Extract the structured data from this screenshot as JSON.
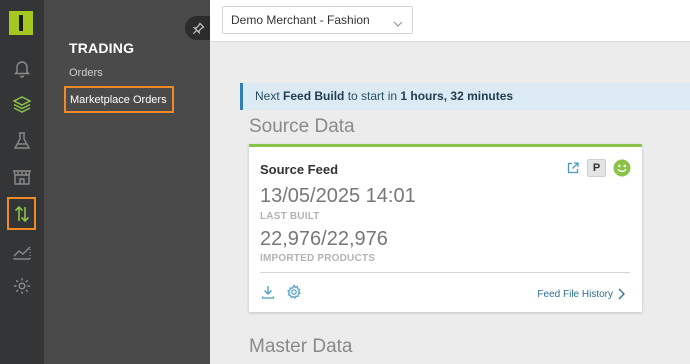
{
  "sidebar": {
    "icons": [
      "logo-icon",
      "bell-icon",
      "layers-icon",
      "flask-icon",
      "store-icon",
      "swap-arrows-icon",
      "area-chart-icon",
      "gear-icon"
    ],
    "active_icon": "swap-arrows-icon",
    "highlight_color": "#f08a24",
    "logo_color": "#a5c81f"
  },
  "subnav": {
    "title": "TRADING",
    "items": [
      {
        "label": "Orders"
      },
      {
        "label": "Marketplace Orders",
        "active": true
      }
    ]
  },
  "header": {
    "merchant_select": {
      "value": "Demo Merchant - Fashion"
    }
  },
  "notice": {
    "prefix": "Next ",
    "feed": "Feed Build",
    "middle": " to start in ",
    "time": "1 hours, 32 minutes"
  },
  "sections": {
    "source_title": "Source Data",
    "master_title": "Master Data"
  },
  "source_card": {
    "title": "Source Feed",
    "badge": "P",
    "status_icon": "smiley-icon",
    "status_color": "#8bc34a",
    "last_built_value": "13/05/2025 14:01",
    "last_built_label": "LAST BUILT",
    "imported_value": "22,976/22,976",
    "imported_label": "IMPORTED PRODUCTS",
    "history_link": "Feed File History"
  }
}
